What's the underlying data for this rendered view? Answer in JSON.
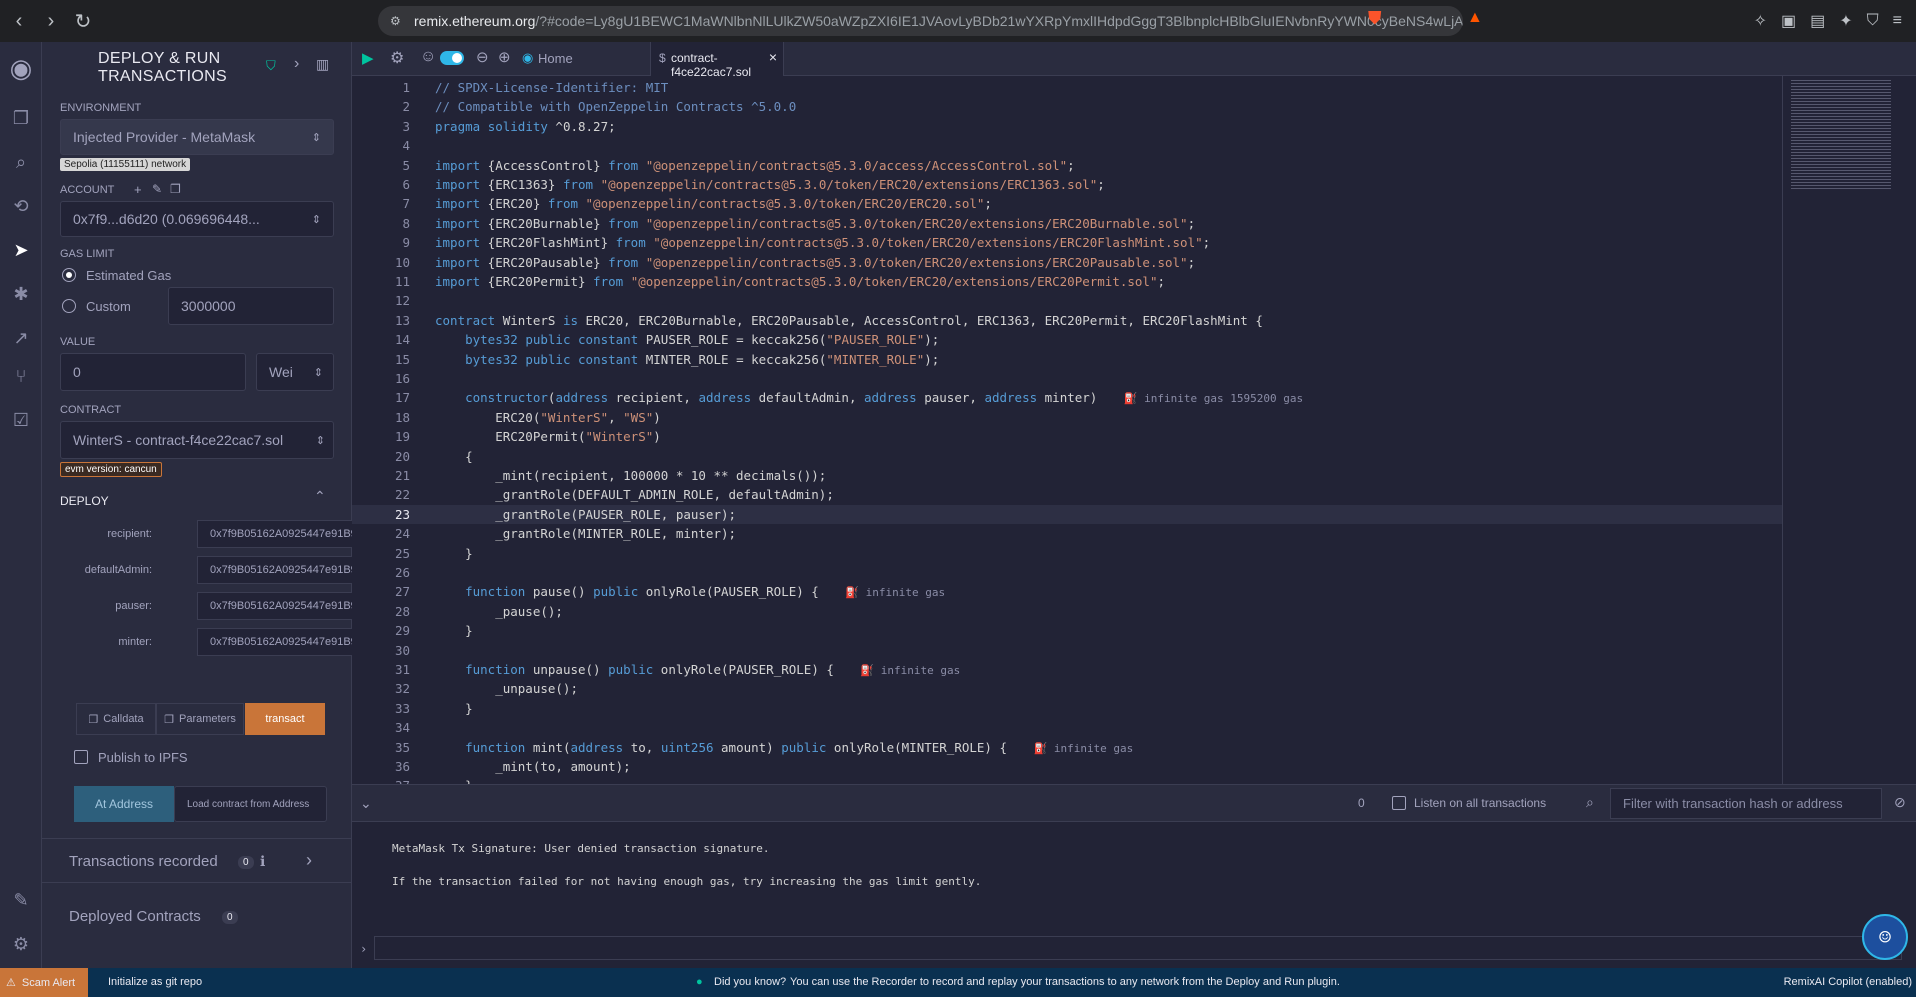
{
  "browser": {
    "url_domain": "remix.ethereum.org",
    "url_rest": "/?#code=Ly8gU1BEWC1MaWNlbnNlLUlkZW50aWZpZXI6IE1JVAovLyBDb21wYXRpYmxlIHdpdGggT3BlbnplcHBlbGluIENvbnRyYWN0cyBeNS4wLjAKcHJhZ21hIHNvbGlkaXR5IF4wLjguMjc7Ci..."
  },
  "panel": {
    "title_line1": "DEPLOY & RUN",
    "title_line2": "TRANSACTIONS",
    "environment_label": "ENVIRONMENT",
    "environment_value": "Injected Provider - MetaMask",
    "network_tag": "Sepolia (11155111) network",
    "account_label": "ACCOUNT",
    "account_value": "0x7f9...d6d20 (0.069696448...",
    "gas_limit_label": "GAS LIMIT",
    "estimated_gas_label": "Estimated Gas",
    "custom_label": "Custom",
    "custom_gas_value": "3000000",
    "value_label": "VALUE",
    "value_amount": "0",
    "value_unit": "Wei",
    "contract_label": "CONTRACT",
    "contract_value": "WinterS - contract-f4ce22cac7.sol",
    "evm_tag": "evm version: cancun",
    "deploy_label": "DEPLOY",
    "args": [
      {
        "name": "recipient:",
        "value": "0x7f9B05162A0925447e91B9..."
      },
      {
        "name": "defaultAdmin:",
        "value": "0x7f9B05162A0925447e91B9..."
      },
      {
        "name": "pauser:",
        "value": "0x7f9B05162A0925447e91B9..."
      },
      {
        "name": "minter:",
        "value": "0x7f9B05162A0925447e91B9..."
      }
    ],
    "calldata_label": "Calldata",
    "parameters_label": "Parameters",
    "transact_label": "transact",
    "publish_label": "Publish to IPFS",
    "at_address_label": "At Address",
    "load_contract_placeholder": "Load contract from Address",
    "transactions_recorded_label": "Transactions recorded",
    "transactions_recorded_count": "0",
    "deployed_contracts_label": "Deployed Contracts",
    "deployed_contracts_count": "0"
  },
  "editor": {
    "home_tab": "Home",
    "file_tab": "contract-f4ce22cac7.sol",
    "current_line": 23
  },
  "code_lines": [
    "// SPDX-License-Identifier: MIT",
    "// Compatible with OpenZeppelin Contracts ^5.0.0",
    "pragma solidity ^0.8.27;",
    "",
    "import {AccessControl} from \"@openzeppelin/contracts@5.3.0/access/AccessControl.sol\";",
    "import {ERC1363} from \"@openzeppelin/contracts@5.3.0/token/ERC20/extensions/ERC1363.sol\";",
    "import {ERC20} from \"@openzeppelin/contracts@5.3.0/token/ERC20/ERC20.sol\";",
    "import {ERC20Burnable} from \"@openzeppelin/contracts@5.3.0/token/ERC20/extensions/ERC20Burnable.sol\";",
    "import {ERC20FlashMint} from \"@openzeppelin/contracts@5.3.0/token/ERC20/extensions/ERC20FlashMint.sol\";",
    "import {ERC20Pausable} from \"@openzeppelin/contracts@5.3.0/token/ERC20/extensions/ERC20Pausable.sol\";",
    "import {ERC20Permit} from \"@openzeppelin/contracts@5.3.0/token/ERC20/extensions/ERC20Permit.sol\";",
    "",
    "contract WinterS is ERC20, ERC20Burnable, ERC20Pausable, AccessControl, ERC1363, ERC20Permit, ERC20FlashMint {",
    "    bytes32 public constant PAUSER_ROLE = keccak256(\"PAUSER_ROLE\");",
    "    bytes32 public constant MINTER_ROLE = keccak256(\"MINTER_ROLE\");",
    "",
    "    constructor(address recipient, address defaultAdmin, address pauser, address minter)",
    "        ERC20(\"WinterS\", \"WS\")",
    "        ERC20Permit(\"WinterS\")",
    "    {",
    "        _mint(recipient, 100000 * 10 ** decimals());",
    "        _grantRole(DEFAULT_ADMIN_ROLE, defaultAdmin);",
    "        _grantRole(PAUSER_ROLE, pauser);",
    "        _grantRole(MINTER_ROLE, minter);",
    "    }",
    "",
    "    function pause() public onlyRole(PAUSER_ROLE) {",
    "        _pause();",
    "    }",
    "",
    "    function unpause() public onlyRole(PAUSER_ROLE) {",
    "        _unpause();",
    "    }",
    "",
    "    function mint(address to, uint256 amount) public onlyRole(MINTER_ROLE) {",
    "        _mint(to, amount);",
    "    }"
  ],
  "gas_hints": [
    {
      "line": 17,
      "text": "infinite gas 1595200 gas"
    },
    {
      "line": 27,
      "text": "infinite gas"
    },
    {
      "line": 31,
      "text": "infinite gas"
    },
    {
      "line": 35,
      "text": "infinite gas"
    }
  ],
  "terminal": {
    "pending_count": "0",
    "listen_label": "Listen on all transactions",
    "filter_placeholder": "Filter with transaction hash or address",
    "lines": [
      "MetaMask Tx Signature: User denied transaction signature.",
      "If the transaction failed for not having enough gas, try increasing the gas limit gently."
    ]
  },
  "status": {
    "scam_alert": "Scam Alert",
    "git_init": "Initialize as git repo",
    "did_you_know": "Did you know?",
    "tip": "You can use the Recorder to record and replay your transactions to any network from the Deploy and Run plugin.",
    "copilot": "RemixAI Copilot (enabled)"
  }
}
